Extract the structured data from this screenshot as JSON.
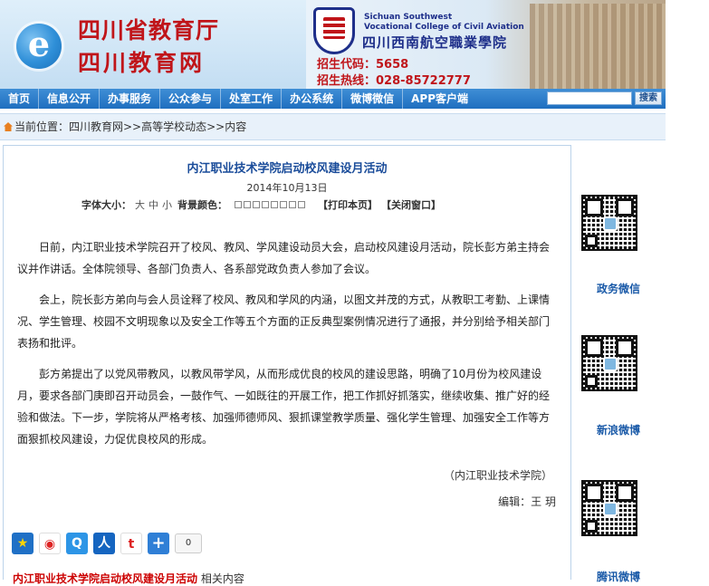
{
  "header": {
    "logo_line1": "四川省教育厅",
    "logo_line2": "四川教育网",
    "ad": {
      "en_line1": "Sichuan Southwest",
      "en_line2": "Vocational College of Civil Aviation",
      "cn_name": "四川西南航空職業學院",
      "code_line": "招生代码：5658",
      "hotline": "招生热线：028-85722777"
    }
  },
  "nav": {
    "items": [
      "首页",
      "信息公开",
      "办事服务",
      "公众参与",
      "处室工作",
      "办公系统",
      "微博微信",
      "APP客户端"
    ],
    "search_value": "",
    "search_button": "搜索"
  },
  "breadcrumb": {
    "text": "当前位置：四川教育网>>高等学校动态>>内容"
  },
  "article": {
    "title": "内江职业技术学院启动校风建设月活动",
    "date": "2014年10月13日",
    "font_size_label": "字体大小：",
    "size_large": "大",
    "size_mid": "中",
    "size_small": "小",
    "bg_color_label": "背景颜色：",
    "print_link": "【打印本页】",
    "close_link": "【关闭窗口】",
    "paragraphs": [
      "日前，内江职业技术学院召开了校风、教风、学风建设动员大会，启动校风建设月活动，院长彭方弟主持会议并作讲话。全体院领导、各部门负责人、各系部党政负责人参加了会议。",
      "会上，院长彭方弟向与会人员诠释了校风、教风和学风的内涵，以图文并茂的方式，从教职工考勤、上课情况、学生管理、校园不文明现象以及安全工作等五个方面的正反典型案例情况进行了通报，并分别给予相关部门表扬和批评。",
      "彭方弟提出了以党风带教风，以教风带学风，从而形成优良的校风的建设思路，明确了10月份为校风建设月，要求各部门庚即召开动员会，一鼓作气、一如既往的开展工作，把工作抓好抓落实，继续收集、推广好的经验和做法。下一步，学院将从严格考核、加强师德师风、狠抓课堂教学质量、强化学生管理、加强安全工作等方面狠抓校风建设，力促优良校风的形成。"
    ],
    "source": "（内江职业技术学院）",
    "editor": "编辑：王 玥"
  },
  "share": {
    "count": "0"
  },
  "related": {
    "title": "内江职业技术学院启动校风建设月活动",
    "suffix": "相关内容"
  },
  "sidebar": {
    "qr_labels": [
      "政务微信",
      "新浪微博",
      "腾讯微博"
    ]
  },
  "colors": {
    "nav_blue": "#1f6fbf",
    "title_red": "#c0151a",
    "link_blue": "#1a4c9a"
  }
}
